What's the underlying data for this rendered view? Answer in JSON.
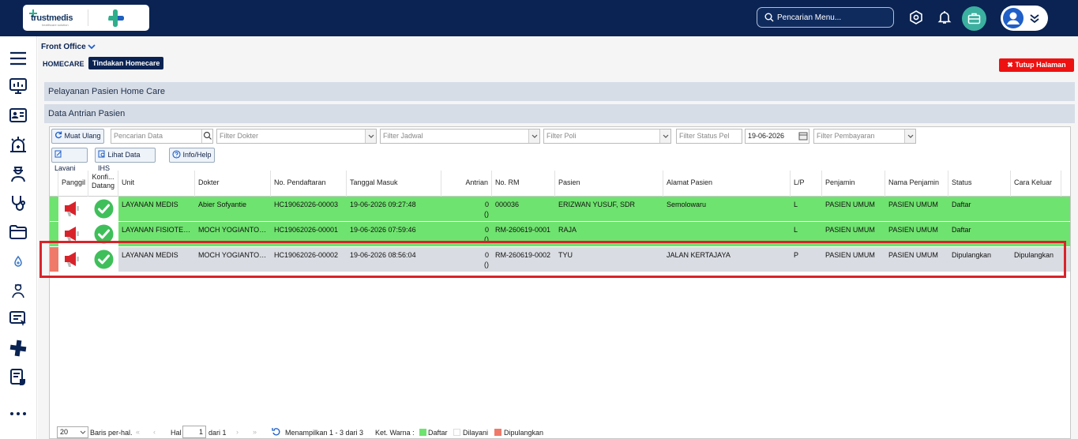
{
  "app": {
    "logo_text": "trustmedis",
    "logo_sub": "healthcare solution"
  },
  "topbar": {
    "search_placeholder": "Pencarian Menu..."
  },
  "breadcrumb": {
    "module": "Front Office",
    "item1": "HOMECARE",
    "item2": "Tindakan Homecare"
  },
  "close_button": "✖ Tutup Halaman",
  "panels": {
    "title1": "Pelayanan Pasien Home Care",
    "title2": "Data Antrian Pasien"
  },
  "toolbar": {
    "reload": "Muat Ulang",
    "search_placeholder": "Pencarian Data",
    "doctor_filter": "Filter Dokter",
    "schedule_filter": "Filter Jadwal",
    "poli_filter": "Filter Poli",
    "status_filter": "Filter Status Pel",
    "date": "19-06-2026",
    "payment_filter": "Filter Pembayaran",
    "serve": "Layani",
    "ihs": "Lihat Data IHS",
    "help": "Info/Help"
  },
  "columns": [
    "Panggil",
    "Konfi... Datang",
    "Unit",
    "Dokter",
    "No. Pendaftaran",
    "Tanggal Masuk",
    "Antrian",
    "No. RM",
    "Pasien",
    "Alamat Pasien",
    "L/P",
    "Penjamin",
    "Nama Penjamin",
    "Status",
    "Cara Keluar"
  ],
  "rows": [
    {
      "unit": "LAYANAN MEDIS",
      "dokter": "Abier Sofyantie",
      "no_daftar": "HC19062026-00003",
      "tanggal": "19-06-2026 09:27:48",
      "antrian": "0",
      "antrian2": "()",
      "no_rm": "000036",
      "pasien": "ERIZWAN YUSUF, SDR",
      "alamat": "Semolowaru",
      "lp": "L",
      "penjamin": "PASIEN UMUM",
      "nama_penjamin": "PASIEN UMUM",
      "status": "Daftar",
      "cara_keluar": ""
    },
    {
      "unit": "LAYANAN FISIOTERAPI",
      "dokter": "MOCH YOGIANTORO",
      "no_daftar": "HC19062026-00001",
      "tanggal": "19-06-2026 07:59:46",
      "antrian": "0",
      "antrian2": "()",
      "no_rm": "RM-260619-0001",
      "pasien": "RAJA",
      "alamat": "",
      "lp": "L",
      "penjamin": "PASIEN UMUM",
      "nama_penjamin": "PASIEN UMUM",
      "status": "Daftar",
      "cara_keluar": ""
    },
    {
      "unit": "LAYANAN MEDIS",
      "dokter": "MOCH YOGIANTORO",
      "no_daftar": "HC19062026-00002",
      "tanggal": "19-06-2026 08:56:04",
      "antrian": "0",
      "antrian2": "()",
      "no_rm": "RM-260619-0002",
      "pasien": "TYU",
      "alamat": "JALAN KERTAJAYA",
      "lp": "P",
      "penjamin": "PASIEN UMUM",
      "nama_penjamin": "PASIEN UMUM",
      "status": "Dipulangkan",
      "cara_keluar": "Dipulangkan"
    }
  ],
  "footer": {
    "page_size": "20",
    "per_page": "Baris per-hal.",
    "hal": "Hal",
    "page": "1",
    "of": "dari 1",
    "showing": "Menampilkan 1 - 3 dari 3",
    "legend_title": "Ket. Warna :",
    "legend": [
      "Daftar",
      "Dilayani",
      "Dipulangkan"
    ]
  },
  "colors": {
    "daftar": "#6fe36f",
    "dilayani": "#ffffff",
    "dipulangkan": "#f07a6a",
    "navy": "#0a2352",
    "dipulangkan_row": "#d9dce2"
  }
}
